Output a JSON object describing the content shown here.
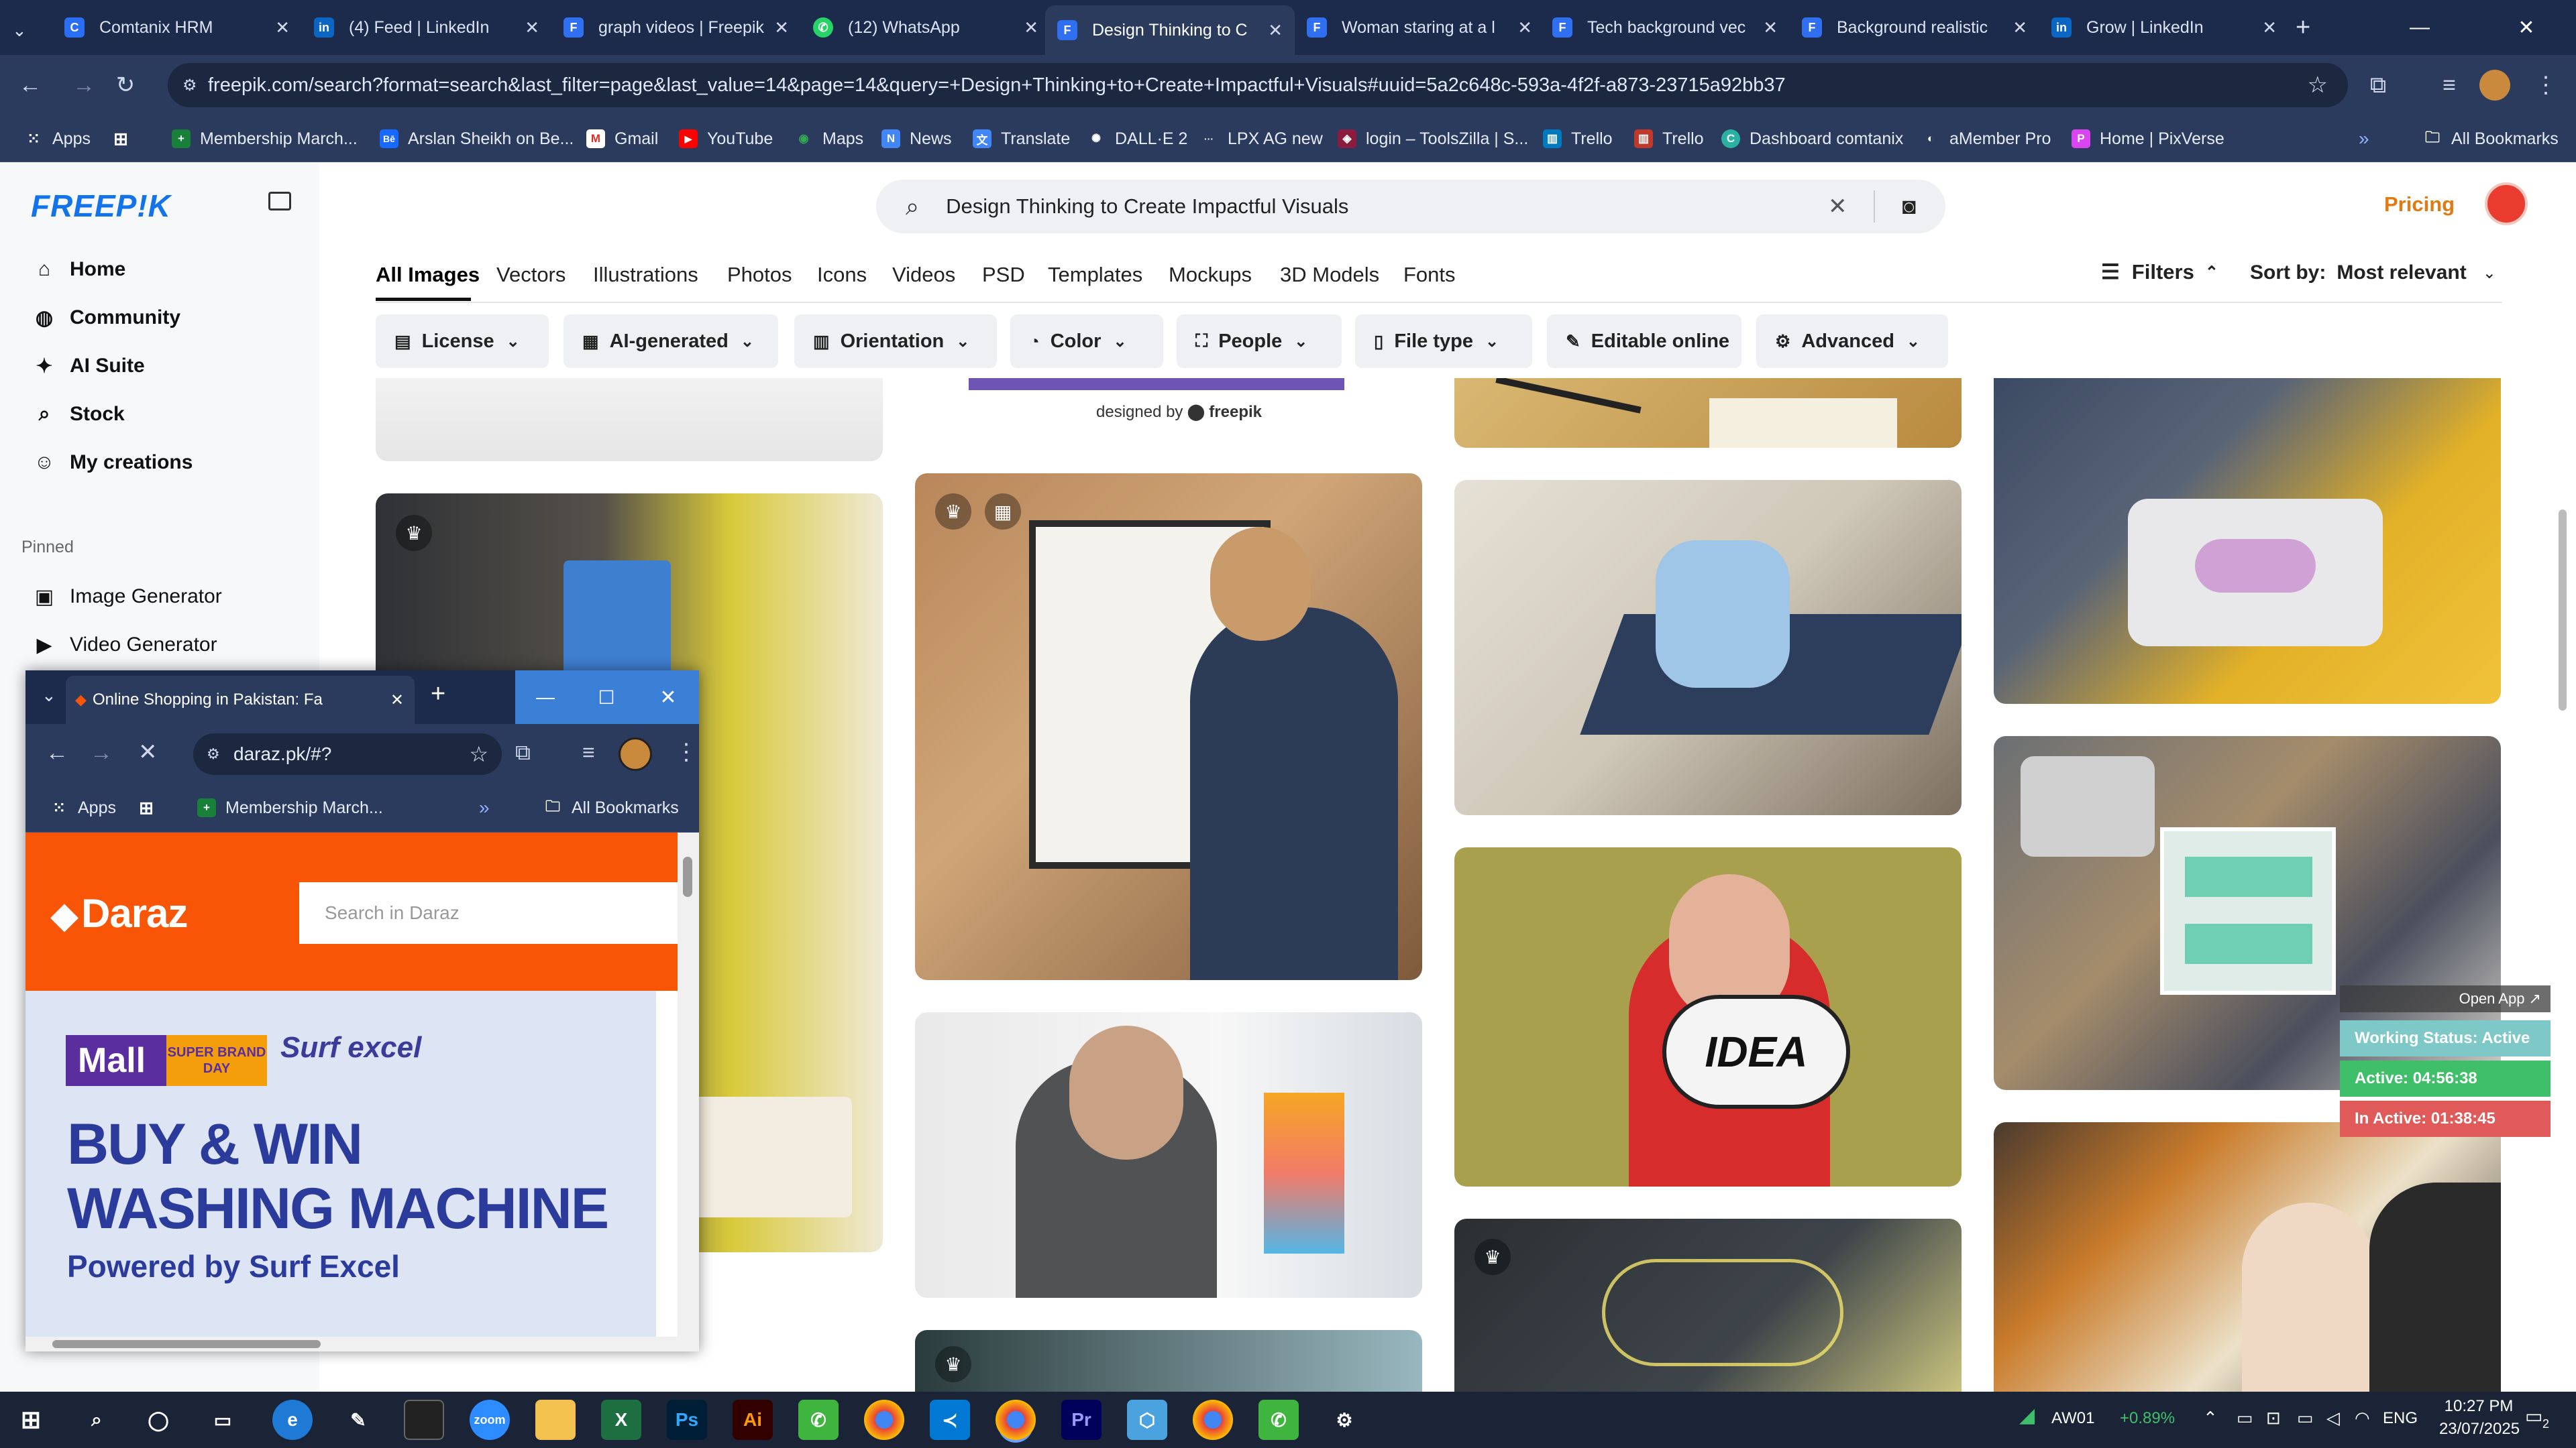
{
  "browser": {
    "tabs": [
      {
        "title": "Comtanix HRM",
        "icon": "comtanix-icon",
        "color": "#2a6ef5"
      },
      {
        "title": "(4) Feed | LinkedIn",
        "icon": "linkedin-icon",
        "color": "#0a66c2"
      },
      {
        "title": "graph videos | Freepik",
        "icon": "freepik-icon",
        "color": "#2f6ff0"
      },
      {
        "title": "(12) WhatsApp",
        "icon": "whatsapp-icon",
        "color": "#25d366"
      },
      {
        "title": "Design Thinking to C",
        "icon": "freepik-icon",
        "color": "#2f6ff0"
      },
      {
        "title": "Woman staring at a l",
        "icon": "freepik-icon",
        "color": "#2f6ff0"
      },
      {
        "title": "Tech background vec",
        "icon": "freepik-icon",
        "color": "#2f6ff0"
      },
      {
        "title": "Background realistic",
        "icon": "freepik-icon",
        "color": "#2f6ff0"
      },
      {
        "title": "Grow | LinkedIn",
        "icon": "linkedin-icon",
        "color": "#0a66c2"
      }
    ],
    "url": "freepik.com/search?format=search&last_filter=page&last_value=14&page=14&query=+Design+Thinking+to+Create+Impactful+Visuals#uuid=5a2c648c-593a-4f2f-a873-23715a92bb37",
    "bookmarks": [
      "Apps",
      "Membership March...",
      "Arslan Sheikh on Be...",
      "Gmail",
      "YouTube",
      "Maps",
      "News",
      "Translate",
      "DALL·E 2",
      "LPX AG new",
      "login – ToolsZilla | S...",
      "Trello",
      "Trello",
      "Dashboard comtanix",
      "aMember Pro",
      "Home | PixVerse"
    ],
    "all_bookmarks": "All Bookmarks"
  },
  "freepik": {
    "logo": "FREEP!K",
    "nav": [
      {
        "label": "Home",
        "icon": "home-icon"
      },
      {
        "label": "Community",
        "icon": "globe-icon"
      },
      {
        "label": "AI Suite",
        "icon": "sparkle-icon"
      },
      {
        "label": "Stock",
        "icon": "search-icon"
      },
      {
        "label": "My creations",
        "icon": "user-icon"
      }
    ],
    "pinned_label": "Pinned",
    "pinned": [
      {
        "label": "Image Generator",
        "icon": "image-icon"
      },
      {
        "label": "Video Generator",
        "icon": "video-icon"
      }
    ],
    "search_query": "Design Thinking to Create Impactful Visuals",
    "pricing": "Pricing",
    "categories": [
      "All Images",
      "Vectors",
      "Illustrations",
      "Photos",
      "Icons",
      "Videos",
      "PSD",
      "Templates",
      "Mockups",
      "3D Models",
      "Fonts"
    ],
    "filters_label": "Filters",
    "sort_label": "Sort by:",
    "sort_value": "Most relevant",
    "chips": [
      {
        "label": "License",
        "icon": "doc-icon"
      },
      {
        "label": "AI-generated",
        "icon": "ai-icon"
      },
      {
        "label": "Orientation",
        "icon": "layout-icon"
      },
      {
        "label": "Color",
        "icon": "palette-icon"
      },
      {
        "label": "People",
        "icon": "people-icon"
      },
      {
        "label": "File type",
        "icon": "file-icon"
      },
      {
        "label": "Editable online",
        "icon": "pen-icon"
      },
      {
        "label": "Advanced",
        "icon": "gear-icon"
      }
    ],
    "designed_by": "designed by",
    "designed_by_brand": "freepik",
    "idea_text": "IDEA"
  },
  "popup": {
    "tab_title": "Online Shopping in Pakistan: Fa",
    "url": "daraz.pk/#?",
    "bookmarks": [
      "Apps",
      "Membership March..."
    ],
    "all_bookmarks": "All Bookmarks",
    "daraz_logo": "Daraz",
    "search_placeholder": "Search in Daraz",
    "mall": "Mall",
    "super_brand_day": "SUPER BRAND DAY",
    "surf": "Surf excel",
    "headline1": "BUY & WIN",
    "headline2": "WASHING MACHINE",
    "powered": "Powered by Surf Excel"
  },
  "widget": {
    "open_app": "Open App ↗",
    "status": "Working Status: Active",
    "active": "Active: 04:56:38",
    "inactive": "In Active: 01:38:45",
    "colors": {
      "status": "#7ec8c8",
      "active": "#3fbf6a",
      "inactive": "#e05a5a"
    }
  },
  "taskbar": {
    "ticker": "AW01",
    "change": "+0.89%",
    "lang": "ENG",
    "time": "10:27 PM",
    "date": "23/07/2025",
    "notifications": "2"
  }
}
